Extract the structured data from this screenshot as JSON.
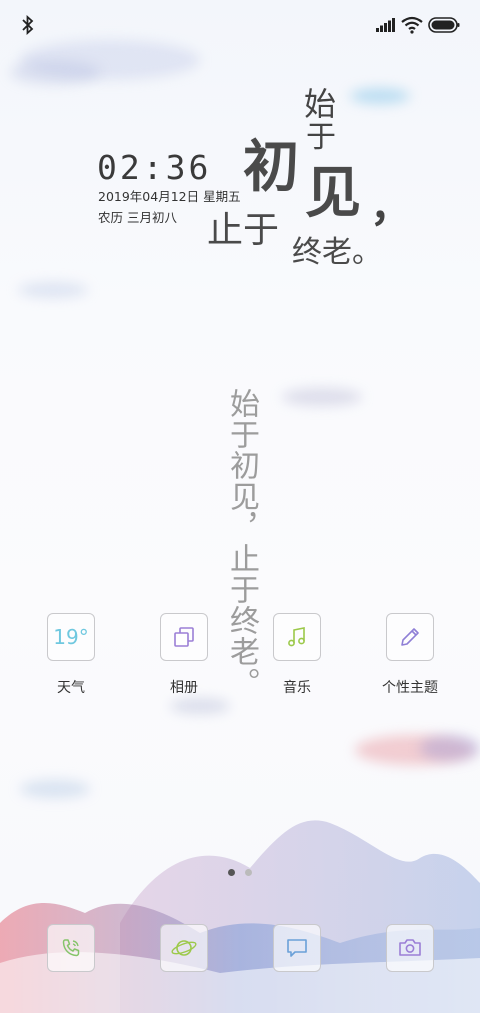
{
  "status_bar": {
    "left_icon": "bluetooth-icon",
    "right_icons": [
      "signal-icon",
      "wifi-icon",
      "battery-icon"
    ]
  },
  "clock": {
    "time": "02:36",
    "date": "2019年04月12日 星期五",
    "lunar": "农历 三月初八"
  },
  "poem": {
    "line1": "始",
    "line2": "于",
    "line3": "初",
    "line4": "见",
    "comma": "，",
    "line5": "止于",
    "line6": "终老。",
    "vertical": "始于初见，止于终老。"
  },
  "apps": [
    {
      "label": "天气",
      "icon": "weather-icon",
      "value": "19°"
    },
    {
      "label": "相册",
      "icon": "gallery-icon"
    },
    {
      "label": "音乐",
      "icon": "music-icon"
    },
    {
      "label": "个性主题",
      "icon": "theme-brush-icon"
    }
  ],
  "dock": [
    {
      "icon": "phone-icon"
    },
    {
      "icon": "browser-planet-icon"
    },
    {
      "icon": "messages-icon"
    },
    {
      "icon": "camera-icon"
    }
  ],
  "page_indicator": {
    "count": 2,
    "active": 1
  },
  "colors": {
    "weather_accent": "#6fc8df",
    "gallery_accent": "#9b7fd6",
    "music_accent": "#9cc94a",
    "theme_accent": "#8f7fd6",
    "phone_accent": "#86c46a",
    "browser_accent": "#9cc94a",
    "messages_accent": "#6aa0d8",
    "camera_accent": "#9b7fd6"
  }
}
